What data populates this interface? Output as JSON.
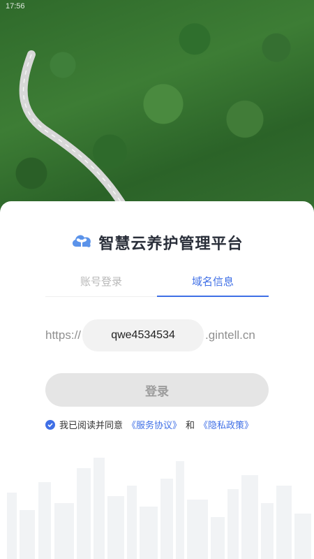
{
  "status_bar": {
    "time": "17:56"
  },
  "brand": {
    "title": "智慧云养护管理平台"
  },
  "tabs": [
    {
      "label": "账号登录",
      "active": false
    },
    {
      "label": "域名信息",
      "active": true
    }
  ],
  "domain": {
    "prefix": "https://",
    "value": "qwe4534534",
    "suffix": ".gintell.cn"
  },
  "login_button": {
    "label": "登录"
  },
  "agreement": {
    "checked": true,
    "text_before": "我已阅读并同意",
    "service_link": "《服务协议》",
    "conjunction": "和",
    "privacy_link": "《隐私政策》"
  },
  "colors": {
    "accent": "#3f6fe6",
    "button_bg": "#e5e5e5"
  }
}
